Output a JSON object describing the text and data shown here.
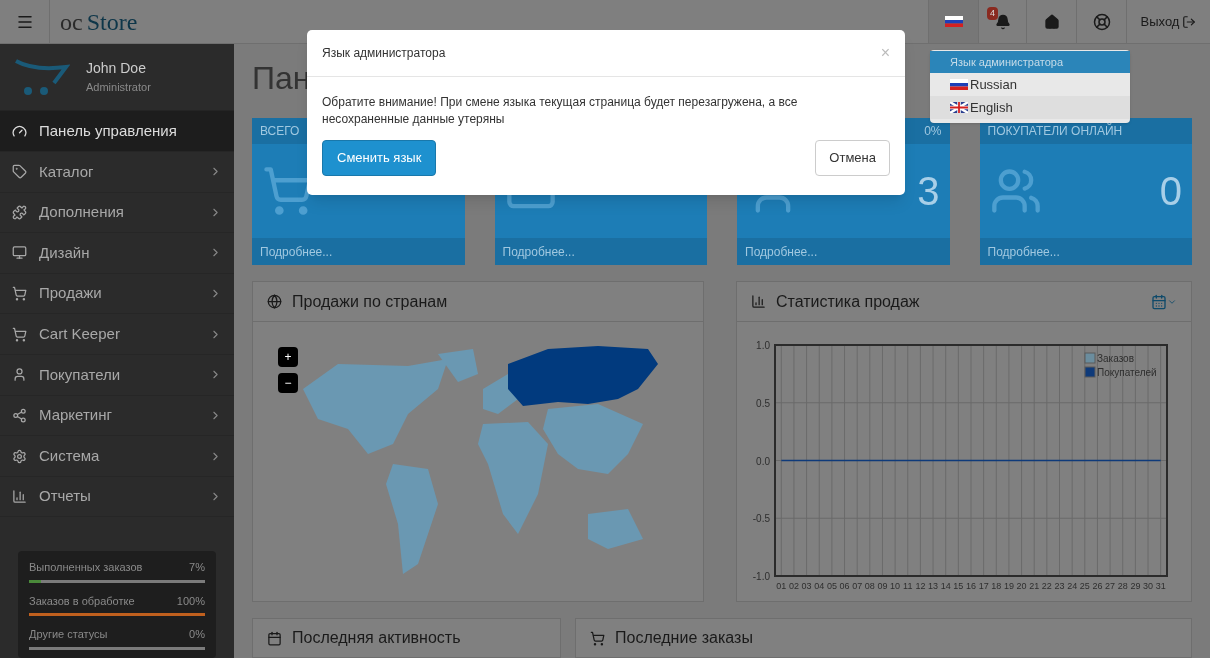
{
  "header": {
    "logo": {
      "prefix": "oc",
      "name": "Store"
    },
    "notifications_badge": "4",
    "logout": "Выход"
  },
  "language_menu": {
    "heading": "Язык администратора",
    "items": [
      {
        "label": "Russian",
        "kind": "ru"
      },
      {
        "label": "English",
        "kind": "gb"
      }
    ]
  },
  "user": {
    "name": "John Doe",
    "role": "Administrator"
  },
  "sidebar": {
    "items": [
      {
        "label": "Панель управления",
        "kind": "dashboard",
        "selected": true,
        "expandable": false
      },
      {
        "label": "Каталог",
        "kind": "tags",
        "selected": false,
        "expandable": true
      },
      {
        "label": "Дополнения",
        "kind": "puzzle",
        "selected": false,
        "expandable": true
      },
      {
        "label": "Дизайн",
        "kind": "monitor",
        "selected": false,
        "expandable": true
      },
      {
        "label": "Продажи",
        "kind": "cart",
        "selected": false,
        "expandable": true
      },
      {
        "label": "Cart Keeper",
        "kind": "cart",
        "selected": false,
        "expandable": true
      },
      {
        "label": "Покупатели",
        "kind": "user",
        "selected": false,
        "expandable": true
      },
      {
        "label": "Маркетинг",
        "kind": "share",
        "selected": false,
        "expandable": true
      },
      {
        "label": "Система",
        "kind": "gear",
        "selected": false,
        "expandable": true
      },
      {
        "label": "Отчеты",
        "kind": "chart",
        "selected": false,
        "expandable": true
      }
    ]
  },
  "order_stats": [
    {
      "label": "Выполненных заказов",
      "reading": "7%",
      "level": 0.07,
      "color": "#4a8a3a"
    },
    {
      "label": "Заказов в обработке",
      "reading": "100%",
      "level": 1.0,
      "color": "#c0601e"
    },
    {
      "label": "Другие статусы",
      "reading": "0%",
      "level": 0.0
    }
  ],
  "page_title": "Пан",
  "tiles": [
    {
      "heading": "ВСЕГО",
      "footer": "Подробнее...",
      "kind": "cart"
    },
    {
      "footer": "Подробнее...",
      "kind": "card"
    },
    {
      "badge": "0%",
      "value": "3",
      "footer": "Подробнее...",
      "kind": "user"
    },
    {
      "heading": "ПОКУПАТЕЛИ ОНЛАЙН",
      "value": "0",
      "footer": "Подробнее...",
      "kind": "users"
    }
  ],
  "map_panel": {
    "title": "Продажи по странам",
    "zoom_in": "+",
    "zoom_out": "−"
  },
  "chart_panel": {
    "title": "Статистика продаж",
    "chart_data": {
      "type": "line",
      "grid": true,
      "legend": true,
      "categories": [
        "01",
        "02",
        "03",
        "04",
        "05",
        "06",
        "07",
        "08",
        "09",
        "10",
        "11",
        "12",
        "13",
        "14",
        "15",
        "16",
        "17",
        "18",
        "19",
        "20",
        "21",
        "22",
        "23",
        "24",
        "25",
        "26",
        "27",
        "28",
        "29",
        "30",
        "31"
      ],
      "ylim": [
        -1,
        1
      ],
      "yticks": [
        {
          "value": -1,
          "label": "-1.0"
        },
        {
          "value": -0.5,
          "label": "-0.5"
        },
        {
          "value": 0,
          "label": "0.0"
        },
        {
          "value": 0.5,
          "label": "0.5"
        },
        {
          "value": 1,
          "label": "1.0"
        }
      ],
      "series": [
        {
          "name": "Заказов",
          "color": "#6b8d9e",
          "values": [
            null,
            null,
            null,
            null,
            null,
            null,
            null,
            null,
            null,
            null,
            null,
            null,
            null,
            null,
            null,
            null,
            null,
            null,
            null,
            null,
            null,
            null,
            null,
            null,
            null,
            null,
            null,
            null,
            null,
            null,
            null
          ]
        },
        {
          "name": "Покупателей",
          "color": "#0e3a7a",
          "values": [
            0,
            0,
            0,
            0,
            0,
            0,
            0,
            0,
            0,
            0,
            0,
            0,
            0,
            0,
            0,
            0,
            0,
            0,
            0,
            0,
            0,
            0,
            0,
            0,
            0,
            0,
            0,
            0,
            0,
            0,
            0
          ]
        }
      ]
    }
  },
  "bottom_panels": [
    {
      "title": "Последняя активность",
      "kind": "calendar"
    },
    {
      "title": "Последние заказы",
      "kind": "cart"
    }
  ],
  "modal": {
    "title": "Язык администратора",
    "close": "×",
    "message": "Обратите внимание! При смене языка текущая страница будет перезагружена, а все несохраненные данные утеряны",
    "confirm": "Сменить язык",
    "cancel": "Отмена"
  }
}
